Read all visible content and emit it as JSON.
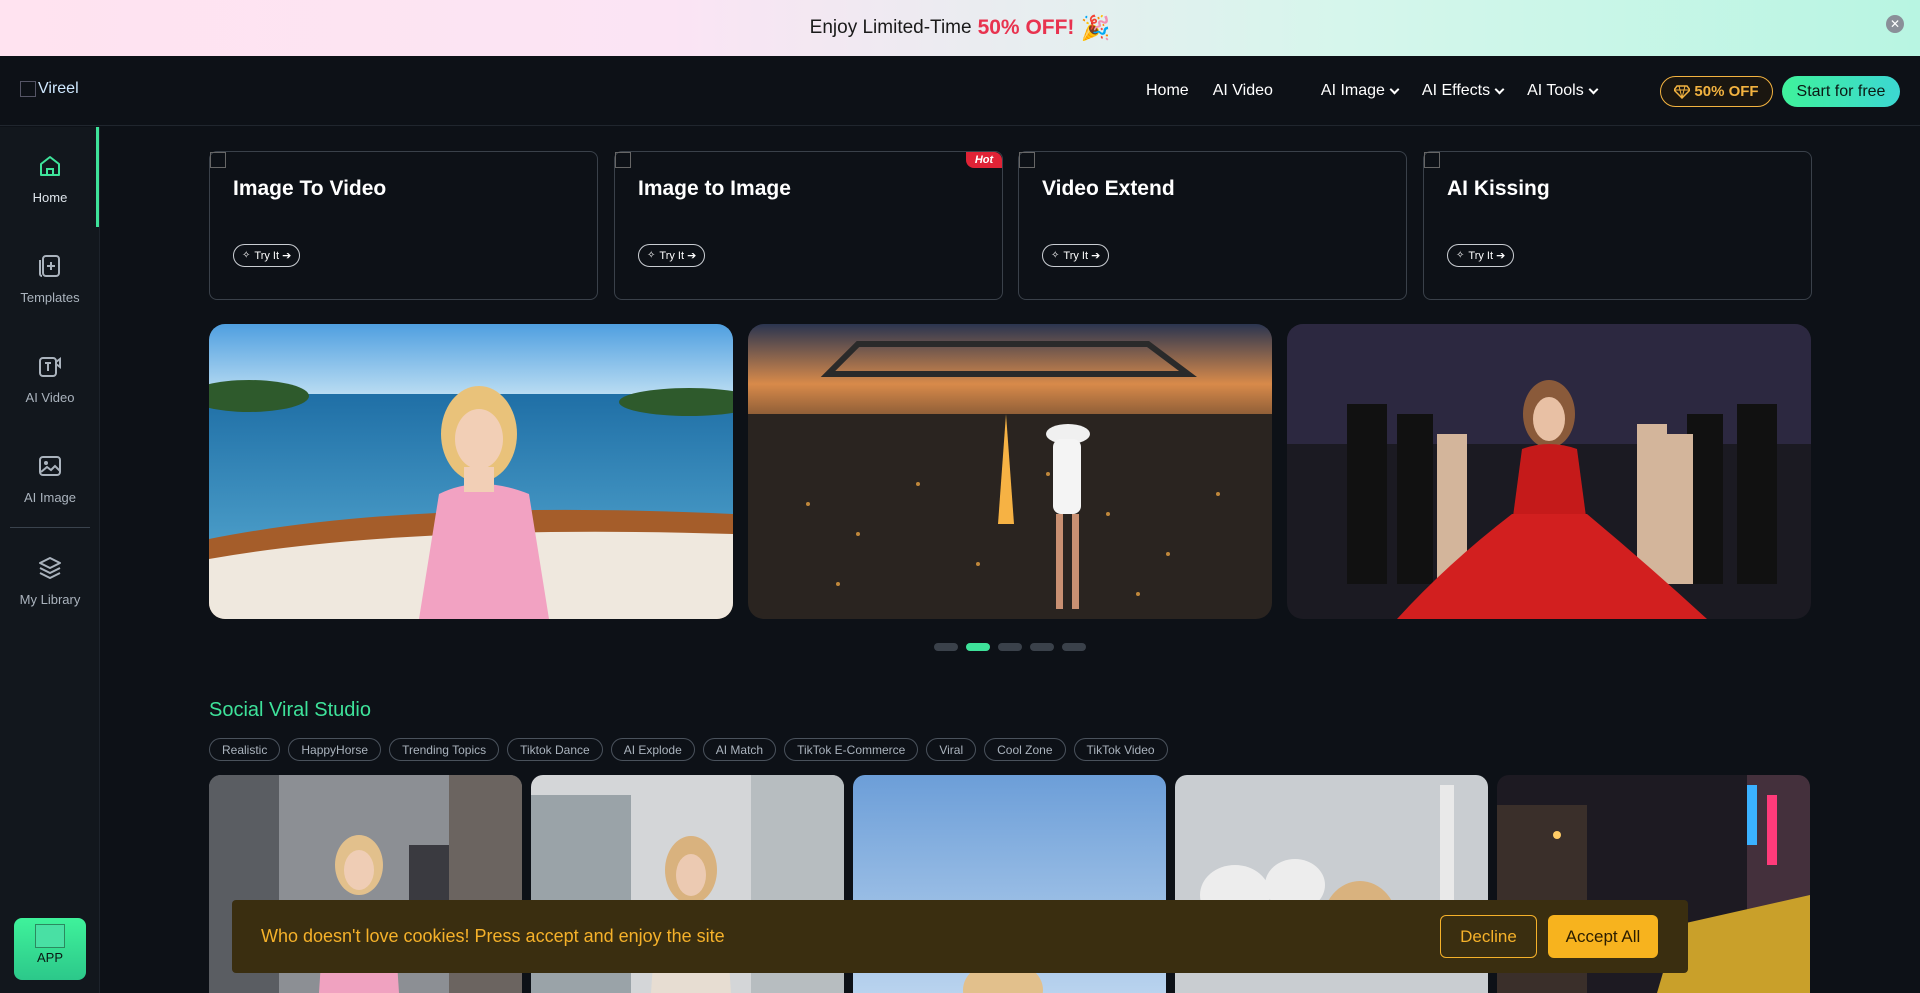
{
  "promo": {
    "text": "Enjoy Limited-Time",
    "highlight": "50% OFF!",
    "emoji": "🎉",
    "close": "✕"
  },
  "nav": {
    "logo_alt": "Vireel",
    "links": [
      {
        "label": "Home",
        "dropdown": false
      },
      {
        "label": "AI Video",
        "dropdown": false
      },
      {
        "label": "AI Image",
        "dropdown": true
      },
      {
        "label": "AI Effects",
        "dropdown": true
      },
      {
        "label": "AI Tools",
        "dropdown": true
      }
    ],
    "discount_label": "50% OFF",
    "start_label": "Start for free"
  },
  "sidebar": {
    "items": [
      {
        "label": "Home",
        "icon": "home-icon"
      },
      {
        "label": "Templates",
        "icon": "templates-icon"
      },
      {
        "label": "AI Video",
        "icon": "ai-video-icon"
      },
      {
        "label": "AI Image",
        "icon": "ai-image-icon"
      },
      {
        "label": "My Library",
        "icon": "layers-icon"
      }
    ],
    "app_label": "APP"
  },
  "features": [
    {
      "title": "Image To Video",
      "button": "Try It ➔",
      "hot": ""
    },
    {
      "title": "Image to Image",
      "button": "Try It ➔",
      "hot": "Hot"
    },
    {
      "title": "Video Extend",
      "button": "Try It ➔",
      "hot": ""
    },
    {
      "title": "AI Kissing",
      "button": "Try It ➔",
      "hot": ""
    }
  ],
  "carousel": {
    "count": 5,
    "active": 1
  },
  "social": {
    "title": "Social Viral Studio",
    "tags": [
      "Realistic",
      "HappyHorse",
      "Trending Topics",
      "Tiktok Dance",
      "AI Explode",
      "AI Match",
      "TikTok E-Commerce",
      " Viral",
      "Cool Zone",
      "TikTok Video"
    ]
  },
  "cookie": {
    "text": "Who doesn't love cookies! Press accept and enjoy the site",
    "decline": "Decline",
    "accept": "Accept All"
  },
  "colors": {
    "accent": "#3ee29a",
    "gold": "#f3b340",
    "hot": "#e02336",
    "cookie_text": "#f5b12a"
  }
}
